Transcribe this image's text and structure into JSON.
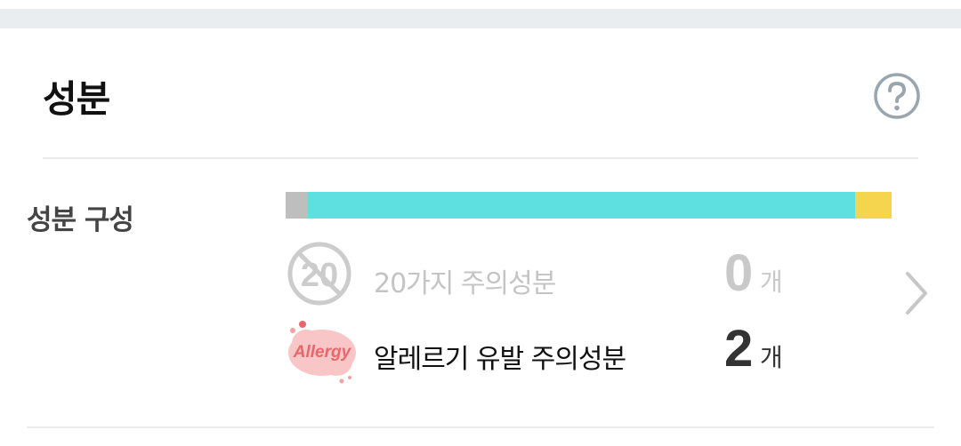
{
  "header": {
    "title": "성분"
  },
  "composition": {
    "label": "성분 구성",
    "bar_segments": [
      {
        "share": 0.037,
        "color": "#bebebe"
      },
      {
        "share": 0.903,
        "color": "#5ee0e0"
      },
      {
        "share": 0.06,
        "color": "#f4d54d"
      }
    ]
  },
  "rows": [
    {
      "badge_text": "20",
      "label": "20가지 주의성분",
      "count": "0",
      "unit": "개",
      "badge_icon": "no-20-icon"
    },
    {
      "badge_text": "Allergy",
      "label": "알레르기 유발 주의성분",
      "count": "2",
      "unit": "개",
      "badge_icon": "allergy-icon"
    }
  ],
  "icons": {
    "help": "question-circle-icon",
    "more": "chevron-right-icon"
  },
  "colors": {
    "muted": "#c4c4c4",
    "text": "#111111",
    "allergy_pink": "#f7b5b5",
    "allergy_red": "#e8676a"
  }
}
